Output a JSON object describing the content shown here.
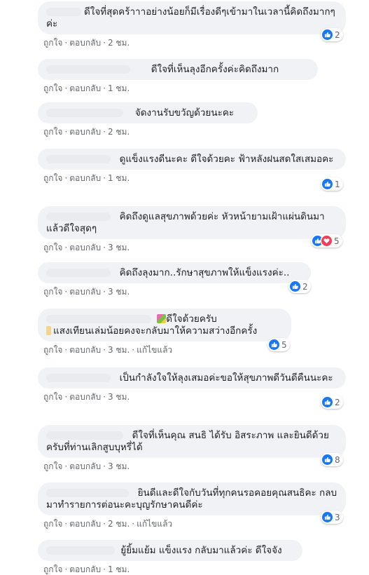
{
  "comments": [
    {
      "text": "ดีใจที่สุดคร้าาาอย่างน้อยก็มีเรื่องดีๆเข้ามาในเวลานี้คิดถึงมากๆค่ะ",
      "like": "ถูกใจ",
      "reply": "ตอบกลับ",
      "time": "2 ชม.",
      "reaction_count": "2"
    },
    {
      "text": "ดีใจที่เห็นลุงอีกครั้งค่ะคิดถึงมาก",
      "like": "ถูกใจ",
      "reply": "ตอบกลับ",
      "time": "1 ชม."
    },
    {
      "text": "จัดงานรับขวัญด้วยนะคะ",
      "like": "ถูกใจ",
      "reply": "ตอบกลับ",
      "time": "2 ชม."
    },
    {
      "text": "ดูแข็งแรงดีนะคะ ดีใจด้วยคะ ฟ้าหลังฝนสดใสเสมอคะ",
      "like": "ถูกใจ",
      "reply": "ตอบกลับ",
      "time": "1 ชม.",
      "reaction_count": "1"
    },
    {
      "text": "คิดถึงดูแลสุขภาพด้วยค่ะ หัวหน้ายามเฝ้าแผ่นดินมาแล้วดีใจสุดๆ",
      "like": "ถูกใจ",
      "reply": "ตอบกลับ",
      "time": "3 ชม.",
      "reaction_count": "5"
    },
    {
      "text": "คิดถึงลุงมาก..รักษาสุขภาพให้แข็งแรงค่ะ..",
      "like": "ถูกใจ",
      "reply": "ตอบกลับ",
      "time": "3 ชม.",
      "reaction_count": "2"
    },
    {
      "text_line1": "ดีใจด้วยครับ",
      "text_line2": "แสงเทียนเล่มน้อยคงจะกลับมาให้ความสว่างอีกครั้ง",
      "like": "ถูกใจ",
      "reply": "ตอบกลับ",
      "time": "3 ชม.",
      "edited": "แก้ไขแล้ว",
      "reaction_count": "5"
    },
    {
      "text": "เป็นกำลังใจให้ลุงเสมอค่ะขอให้สุขภาพดีวันดีคืนนะคะ",
      "like": "ถูกใจ",
      "reply": "ตอบกลับ",
      "time": "3 ชม.",
      "reaction_count": "2"
    },
    {
      "text": "ดีใจที่เห็นคุณ สนธิ ได้รับ อิสระภาพ และยินดีด้วยครับที่ท่านเลิกสูบบุหรี่ได้",
      "like": "ถูกใจ",
      "reply": "ตอบกลับ",
      "time": "3 ชม.",
      "reaction_count": "8"
    },
    {
      "text": "ยินดีและดีใจกับวันที่ทุกคนรอคอยคุณสนธิคะ กลบมาทำรายการต่อนะคะบุญรักษาคนดีค่ะ",
      "like": "ถูกใจ",
      "reply": "ตอบกลับ",
      "time": "2 ชม.",
      "edited": "แก้ไขแล้ว",
      "reaction_count": "3"
    },
    {
      "text": "ยู้ยิ้มแย้ม แข็งแรง กลับมาแล้วค่ะ ดีใจจัง",
      "like": "ถูกใจ",
      "reply": "ตอบกลับ",
      "time": "1 ชม."
    }
  ],
  "colors": {
    "bubble": "#f0f2f5",
    "like_blue": "#1877f2",
    "love_red": "#f33e58",
    "meta_gray": "#65676b"
  },
  "icons": {
    "like": "thumbs-up-icon",
    "love": "heart-icon",
    "sticker": "emoji-icon"
  }
}
